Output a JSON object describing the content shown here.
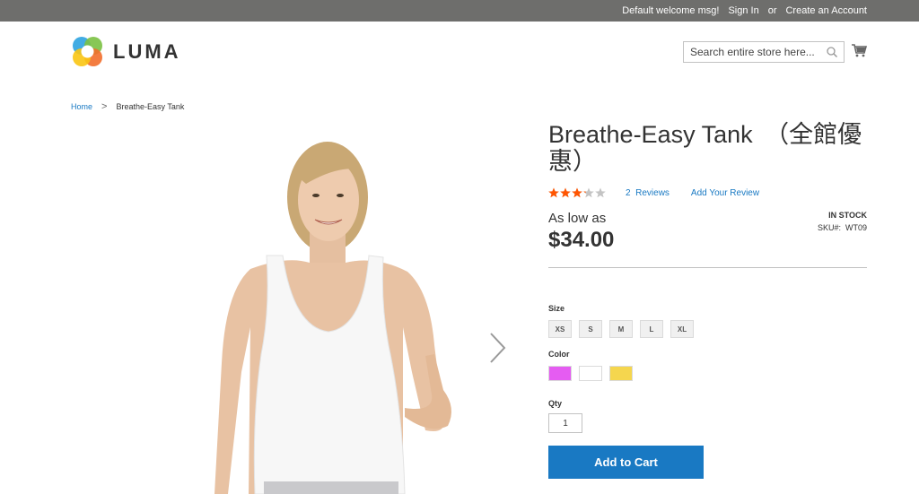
{
  "topbar": {
    "welcome": "Default welcome msg!",
    "sign_in": "Sign In",
    "or": "or",
    "create_account": "Create an Account"
  },
  "header": {
    "logo_text": "LUMA",
    "search_placeholder": "Search entire store here..."
  },
  "breadcrumb": {
    "home": "Home",
    "sep": ">",
    "current": "Breathe-Easy Tank"
  },
  "product": {
    "title": "Breathe-Easy Tank　（全館優惠）",
    "rating_fraction": 0.65,
    "reviews_count": "2",
    "reviews_label": "Reviews",
    "add_review": "Add Your Review",
    "as_low_as": "As low as",
    "price": "$34.00",
    "stock": "IN STOCK",
    "sku_label": "SKU#:",
    "sku": "WT09"
  },
  "options": {
    "size_label": "Size",
    "sizes": [
      "XS",
      "S",
      "M",
      "L",
      "XL"
    ],
    "color_label": "Color",
    "colors": [
      "#e55cf2",
      "#ffffff",
      "#f5d64e"
    ],
    "qty_label": "Qty",
    "qty_value": "1",
    "add_to_cart": "Add to Cart"
  },
  "colors": {
    "topbar": "#6e6e6c",
    "link": "#1979c3",
    "star": "#ff5501",
    "button": "#1979c3"
  }
}
